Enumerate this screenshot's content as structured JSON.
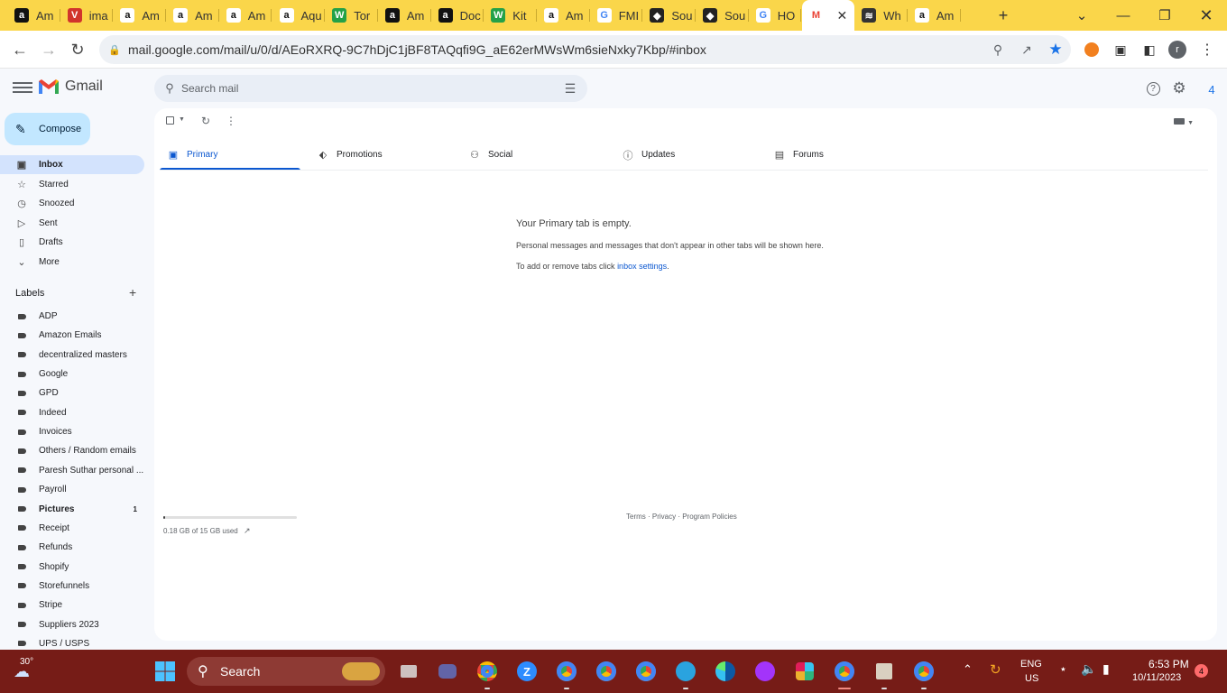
{
  "browser": {
    "tabs": [
      {
        "title": "Am",
        "favicon": "amazon-icon",
        "color": "#111111"
      },
      {
        "title": "ima",
        "favicon": "vivaldi-icon",
        "color": "#d1342c"
      },
      {
        "title": "Am",
        "favicon": "amazon-icon",
        "color": "#ffffff"
      },
      {
        "title": "Am",
        "favicon": "amazon-icon",
        "color": "#ffffff"
      },
      {
        "title": "Am",
        "favicon": "amazon-icon",
        "color": "#ffffff"
      },
      {
        "title": "Aqu",
        "favicon": "amazon-icon",
        "color": "#ffffff"
      },
      {
        "title": "Tor",
        "favicon": "wix-icon",
        "color": "#24a148"
      },
      {
        "title": "Am",
        "favicon": "amazon-icon",
        "color": "#111111"
      },
      {
        "title": "Doc",
        "favicon": "amazon-icon",
        "color": "#111111"
      },
      {
        "title": "Kit",
        "favicon": "wix-icon",
        "color": "#24a148"
      },
      {
        "title": "Am",
        "favicon": "amazon-icon",
        "color": "#ffffff"
      },
      {
        "title": "FMI",
        "favicon": "google-icon",
        "color": "#ffffff"
      },
      {
        "title": "Sou",
        "favicon": "shield-icon",
        "color": "#222222"
      },
      {
        "title": "Sou",
        "favicon": "shield-icon",
        "color": "#222222"
      },
      {
        "title": "HO",
        "favicon": "google-icon",
        "color": "#ffffff"
      },
      {
        "title": "",
        "favicon": "gmail-icon",
        "color": "#ffffff",
        "active": true
      },
      {
        "title": "Wh",
        "favicon": "stripes-icon",
        "color": "#333333"
      },
      {
        "title": "Am",
        "favicon": "amazon-icon",
        "color": "#ffffff"
      }
    ],
    "url": "mail.google.com/mail/u/0/d/AEoRXRQ-9C7hDjC1jBF8TAQqfi9G_aE62erMWsWm6sieNxky7Kbp/#inbox",
    "profile_initial": "r"
  },
  "gmail": {
    "app_name": "Gmail",
    "search_placeholder": "Search mail",
    "account_badge": "4",
    "compose_label": "Compose",
    "nav": [
      {
        "label": "Inbox",
        "icon": "inbox-icon",
        "active": true
      },
      {
        "label": "Starred",
        "icon": "star-icon"
      },
      {
        "label": "Snoozed",
        "icon": "clock-icon"
      },
      {
        "label": "Sent",
        "icon": "send-icon"
      },
      {
        "label": "Drafts",
        "icon": "draft-icon"
      },
      {
        "label": "More",
        "icon": "chevron-down-icon"
      }
    ],
    "labels_heading": "Labels",
    "labels": [
      {
        "label": "ADP",
        "count": ""
      },
      {
        "label": "Amazon Emails",
        "count": ""
      },
      {
        "label": "decentralized masters",
        "count": ""
      },
      {
        "label": "Google",
        "count": ""
      },
      {
        "label": "GPD",
        "count": ""
      },
      {
        "label": "Indeed",
        "count": ""
      },
      {
        "label": "Invoices",
        "count": ""
      },
      {
        "label": "Others / Random emails",
        "count": ""
      },
      {
        "label": "Paresh Suthar personal ...",
        "count": ""
      },
      {
        "label": "Payroll",
        "count": ""
      },
      {
        "label": "Pictures",
        "count": "1",
        "bold": true
      },
      {
        "label": "Receipt",
        "count": ""
      },
      {
        "label": "Refunds",
        "count": ""
      },
      {
        "label": "Shopify",
        "count": ""
      },
      {
        "label": "Storefunnels",
        "count": ""
      },
      {
        "label": "Stripe",
        "count": ""
      },
      {
        "label": "Suppliers 2023",
        "count": ""
      },
      {
        "label": "UPS / USPS",
        "count": ""
      }
    ],
    "tabs": [
      {
        "label": "Primary",
        "icon": "inbox-icon",
        "active": true
      },
      {
        "label": "Promotions",
        "icon": "tag-icon"
      },
      {
        "label": "Social",
        "icon": "people-icon"
      },
      {
        "label": "Updates",
        "icon": "info-icon"
      },
      {
        "label": "Forums",
        "icon": "forum-icon"
      }
    ],
    "empty_title": "Your Primary tab is empty.",
    "empty_desc": "Personal messages and messages that don't appear in other tabs will be shown here.",
    "empty_hint_prefix": "To add or remove tabs click ",
    "empty_hint_link": "inbox settings",
    "empty_hint_suffix": ".",
    "storage_text": "0.18 GB of 15 GB used",
    "storage_fraction": 0.012,
    "footer": "Terms · Privacy · Program Policies"
  },
  "taskbar": {
    "weather": "30°",
    "search_label": "Search",
    "lang_top": "ENG",
    "lang_bottom": "US",
    "time": "6:53 PM",
    "date": "10/11/2023",
    "notification_count": "4"
  }
}
